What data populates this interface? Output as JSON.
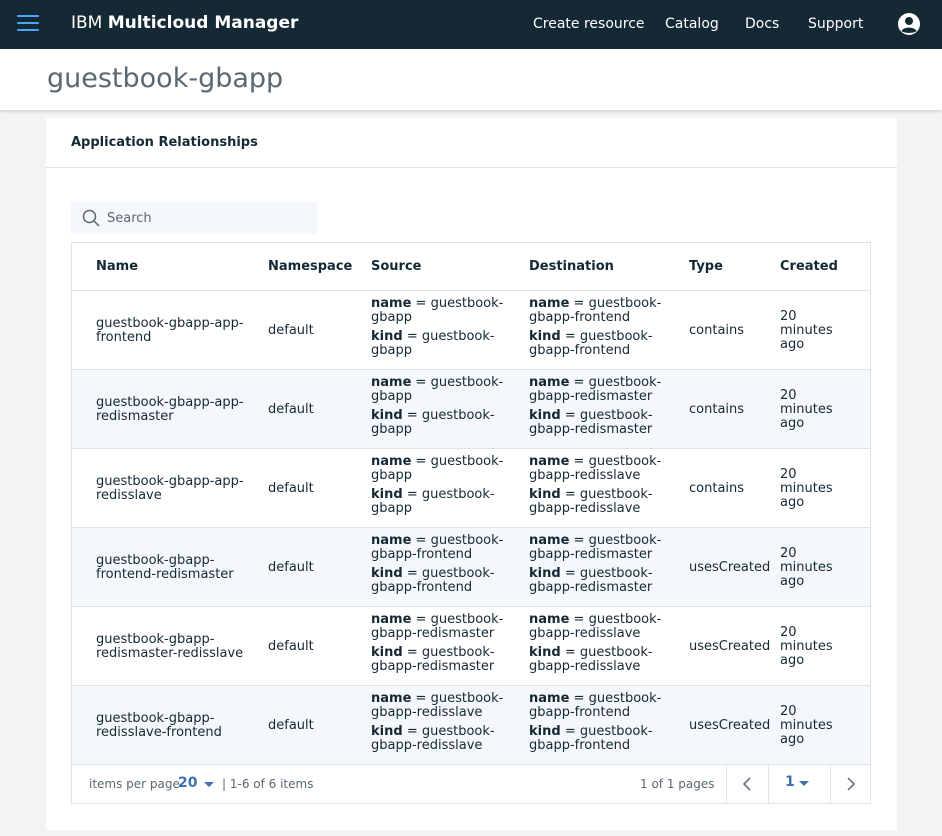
{
  "header": {
    "brand_prefix": "IBM",
    "brand_product": "Multicloud Manager",
    "nav": [
      "Create resource",
      "Catalog",
      "Docs",
      "Support"
    ],
    "menu_icon": "hamburger-menu-icon",
    "user_icon": "user-avatar-icon",
    "accent_color": "#4aa6ff",
    "bar_color": "#152935"
  },
  "page": {
    "title": "guestbook-gbapp"
  },
  "card": {
    "title": "Application Relationships"
  },
  "search": {
    "placeholder": "Search",
    "icon": "search-icon"
  },
  "table": {
    "columns": [
      "Name",
      "Namespace",
      "Source",
      "Destination",
      "Type",
      "Created"
    ],
    "rows": [
      {
        "name": "guestbook-gbapp-app-frontend",
        "namespace": "default",
        "source": {
          "name": "guestbook-gbapp",
          "kind": "guestbook-gbapp"
        },
        "destination": {
          "name": "guestbook-gbapp-frontend",
          "kind": "guestbook-gbapp-frontend"
        },
        "type": "contains",
        "created": "20 minutes ago"
      },
      {
        "name": "guestbook-gbapp-app-redismaster",
        "namespace": "default",
        "source": {
          "name": "guestbook-gbapp",
          "kind": "guestbook-gbapp"
        },
        "destination": {
          "name": "guestbook-gbapp-redismaster",
          "kind": "guestbook-gbapp-redismaster"
        },
        "type": "contains",
        "created": "20 minutes ago"
      },
      {
        "name": "guestbook-gbapp-app-redisslave",
        "namespace": "default",
        "source": {
          "name": "guestbook-gbapp",
          "kind": "guestbook-gbapp"
        },
        "destination": {
          "name": "guestbook-gbapp-redisslave",
          "kind": "guestbook-gbapp-redisslave"
        },
        "type": "contains",
        "created": "20 minutes ago"
      },
      {
        "name": "guestbook-gbapp-frontend-redismaster",
        "namespace": "default",
        "source": {
          "name": "guestbook-gbapp-frontend",
          "kind": "guestbook-gbapp-frontend"
        },
        "destination": {
          "name": "guestbook-gbapp-redismaster",
          "kind": "guestbook-gbapp-redismaster"
        },
        "type": "usesCreated",
        "created": "20 minutes ago"
      },
      {
        "name": "guestbook-gbapp-redismaster-redisslave",
        "namespace": "default",
        "source": {
          "name": "guestbook-gbapp-redismaster",
          "kind": "guestbook-gbapp-redismaster"
        },
        "destination": {
          "name": "guestbook-gbapp-redisslave",
          "kind": "guestbook-gbapp-redisslave"
        },
        "type": "usesCreated",
        "created": "20 minutes ago"
      },
      {
        "name": "guestbook-gbapp-redisslave-frontend",
        "namespace": "default",
        "source": {
          "name": "guestbook-gbapp-redisslave",
          "kind": "guestbook-gbapp-redisslave"
        },
        "destination": {
          "name": "guestbook-gbapp-frontend",
          "kind": "guestbook-gbapp-frontend"
        },
        "type": "usesCreated",
        "created": "20 minutes ago"
      }
    ],
    "key_name_label": "name",
    "key_kind_label": "kind",
    "separator": "="
  },
  "pagination": {
    "items_per_page_label": "items per page",
    "items_per_page_value": "20",
    "range_text": "|  1-6 of 6 items",
    "pages_text": "1 of 1 pages",
    "current_page": "1",
    "prev_icon": "chevron-left-icon",
    "next_icon": "chevron-right-icon"
  }
}
